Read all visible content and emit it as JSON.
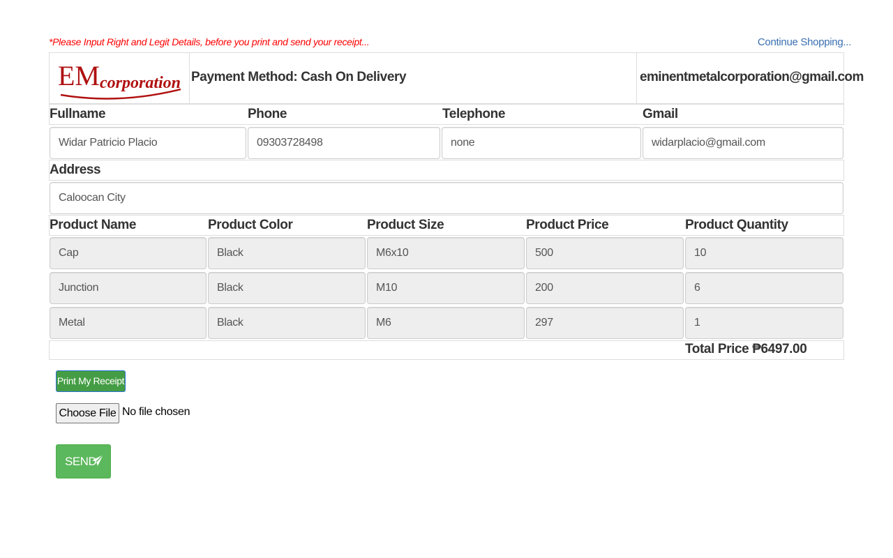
{
  "notice": "*Please Input Right and Legit Details, before you print and send your receipt...",
  "continue_link": "Continue Shopping...",
  "header": {
    "logo_text_main": "EM",
    "logo_text_sub": "corporation",
    "payment_method": "Payment Method: Cash On Delivery",
    "email": "eminentmetalcorporation@gmail.com"
  },
  "customer": {
    "labels": {
      "fullname": "Fullname",
      "phone": "Phone",
      "telephone": "Telephone",
      "gmail": "Gmail",
      "address": "Address"
    },
    "values": {
      "fullname": "Widar Patricio Placio",
      "phone": "09303728498",
      "telephone": "none",
      "gmail": "widarplacio@gmail.com",
      "address": "Caloocan City"
    }
  },
  "products": {
    "headers": [
      "Product Name",
      "Product Color",
      "Product Size",
      "Product Price",
      "Product Quantity"
    ],
    "rows": [
      [
        "Cap",
        "Black",
        "M6x10",
        "500",
        "10"
      ],
      [
        "Junction",
        "Black",
        "M10",
        "200",
        "6"
      ],
      [
        "Metal",
        "Black",
        "M6",
        "297",
        "1"
      ]
    ]
  },
  "total": "Total Price ₱6497.00",
  "actions": {
    "print_label": "Print My Receipt",
    "choose_file_label": "Choose File",
    "no_file_text": "No file chosen",
    "send_label": "SEND",
    "send_icon": "paper-plane-icon"
  },
  "colors": {
    "notice": "#ff0000",
    "link": "#3a6fb0",
    "print_button": "#449d44",
    "send_button": "#5cb85c",
    "logo_red": "#b01010"
  }
}
